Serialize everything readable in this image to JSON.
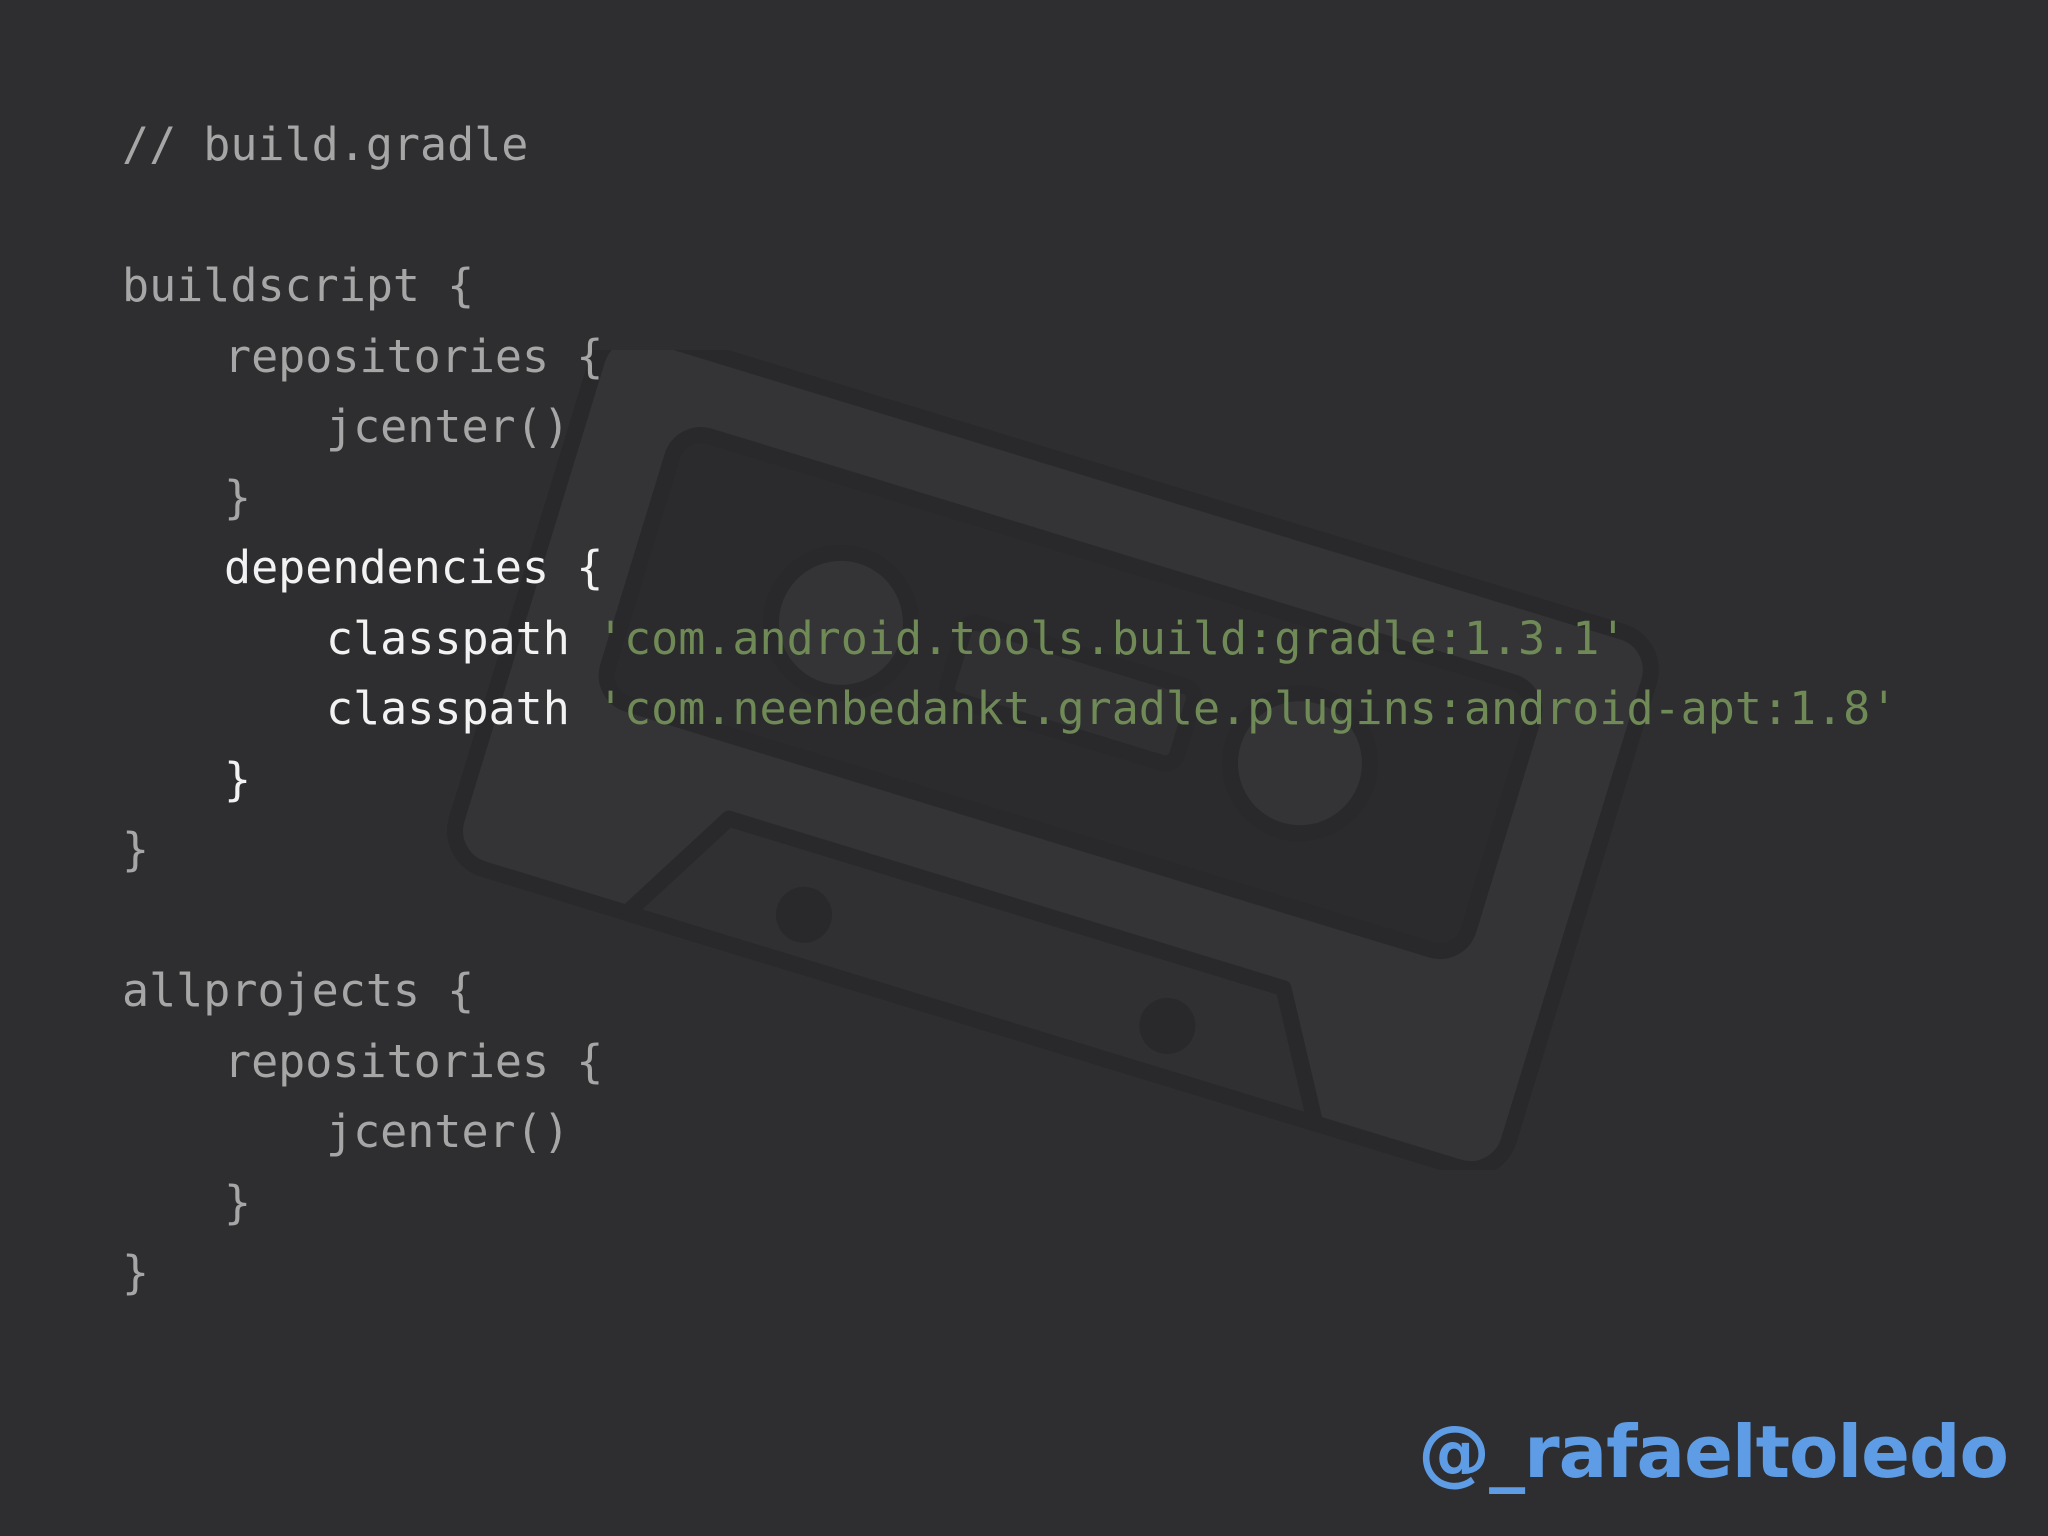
{
  "code": {
    "comment": "// build.gradle",
    "buildscript_open": "buildscript {",
    "bs_repositories_open": "repositories {",
    "bs_jcenter": "jcenter()",
    "bs_repositories_close": "}",
    "dependencies_open": "dependencies {",
    "classpath_keyword_1": "classpath",
    "classpath_value_1": "'com.android.tools.build:gradle:1.3.1'",
    "classpath_keyword_2": "classpath",
    "classpath_value_2": "'com.neenbedankt.gradle.plugins:android-apt:1.8'",
    "dependencies_close": "}",
    "buildscript_close": "}",
    "allprojects_open": "allprojects {",
    "ap_repositories_open": "repositories {",
    "ap_jcenter": "jcenter()",
    "ap_repositories_close": "}",
    "allprojects_close": "}"
  },
  "author_handle": "@_rafaeltoledo",
  "icons": {
    "watermark": "cassette-tape-icon"
  },
  "colors": {
    "background": "#2e2e30",
    "code_dim": "#a6a6a6",
    "code_highlight": "#f2f2f2",
    "string": "#6f8a56",
    "handle": "#5e9de6"
  }
}
